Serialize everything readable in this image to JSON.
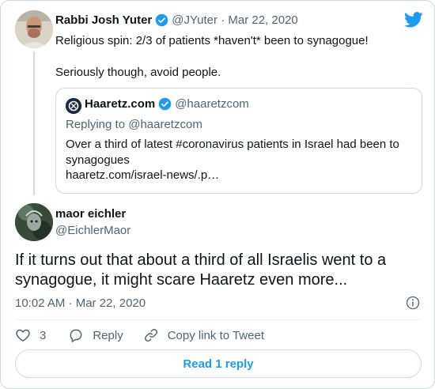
{
  "parent_tweet": {
    "author_name": "Rabbi Josh Yuter",
    "handle": "@JYuter",
    "separator": " · ",
    "date": "Mar 22, 2020",
    "text_lines": [
      "Religious spin: 2/3 of patients *haven't* been to synagogue!",
      "Seriously though, avoid people."
    ]
  },
  "quoted_tweet": {
    "author_name": "Haaretz.com",
    "handle": "@haaretzcom",
    "replying_to": "Replying to @haaretzcom",
    "text": "Over a third of latest #coronavirus patients in Israel had been to synagogues",
    "link": "haaretz.com/israel-news/.p…"
  },
  "main_tweet": {
    "author_name": "maor eichler",
    "handle": "@EichlerMaor",
    "text": "If it turns out that about a third of all Israelis went to a synagogue, it might scare Haaretz even more...",
    "timestamp": "10:02 AM · Mar 22, 2020"
  },
  "actions": {
    "like_count": "3",
    "reply_label": "Reply",
    "copy_link_label": "Copy link to Tweet"
  },
  "read_replies_label": "Read 1 reply",
  "colors": {
    "accent": "#1d9bf0",
    "muted_text": "#536471",
    "border": "#cfd9de",
    "verified": "#1d9bf0"
  },
  "icons": [
    "twitter-bird-icon",
    "verified-badge-icon",
    "info-icon",
    "heart-icon",
    "reply-bubble-icon",
    "link-icon"
  ]
}
